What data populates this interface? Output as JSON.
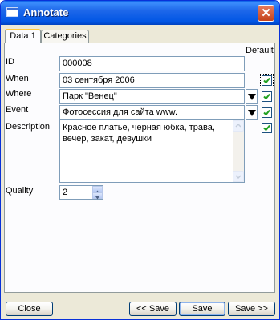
{
  "window": {
    "title": "Annotate",
    "close_glyph": "✕"
  },
  "tabs": [
    {
      "label": "Data 1",
      "active": true
    },
    {
      "label": "Categories",
      "active": false
    }
  ],
  "default_label": "Default",
  "fields": {
    "id": {
      "label": "ID",
      "value": "000008"
    },
    "when": {
      "label": "When",
      "value": "03 сентября 2006",
      "default_checked": true
    },
    "where": {
      "label": "Where",
      "value": "Парк \"Венец\"",
      "default_checked": true
    },
    "event": {
      "label": "Event",
      "value": "Фотосессия для сайта www.",
      "default_checked": true
    },
    "description": {
      "label": "Description",
      "value": "Красное платье, черная юбка, трава, вечер, закат, девушки",
      "default_checked": true
    },
    "quality": {
      "label": "Quality",
      "value": "2"
    }
  },
  "buttons": {
    "close": "Close",
    "prev_save": "<< Save",
    "save": "Save",
    "next_save": "Save >>"
  },
  "colors": {
    "titlebar": "#0055E4",
    "dialog_bg": "#ECE9D8",
    "check": "#21A121"
  }
}
